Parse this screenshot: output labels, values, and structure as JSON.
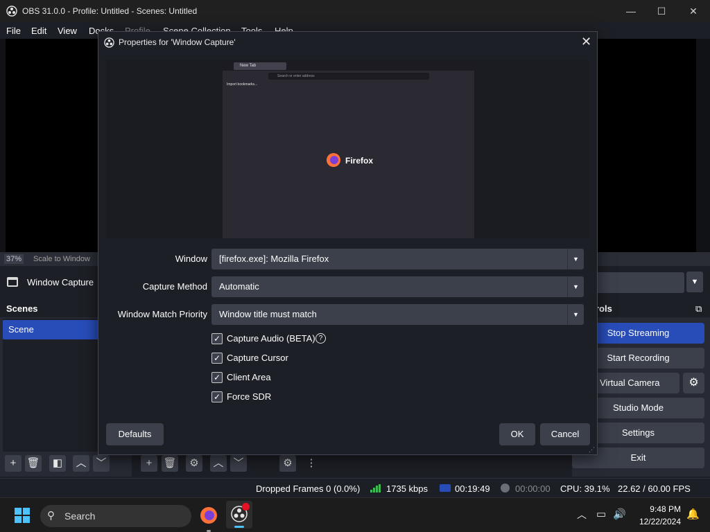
{
  "window": {
    "title": "OBS 31.0.0 - Profile: Untitled - Scenes: Untitled",
    "minimize": "—",
    "maximize": "☐",
    "close": "✕"
  },
  "menu": [
    "File",
    "Edit",
    "View",
    "Docks",
    "Profile",
    "Scene Collection",
    "Tools",
    "Help"
  ],
  "preview": {
    "zoom": "37%",
    "scale": "Scale to Window"
  },
  "source_toolbar": {
    "source_name": "Window Capture"
  },
  "scenes": {
    "title": "Scenes",
    "items": [
      "Scene"
    ]
  },
  "controls": {
    "title_fragment": "rols",
    "buttons": [
      "Stop Streaming",
      "Start Recording",
      "rt Virtual Camera",
      "Studio Mode",
      "Settings",
      "Exit"
    ]
  },
  "status": {
    "dropped_frames": "Dropped Frames 0 (0.0%)",
    "bitrate": "1735 kbps",
    "stream_time": "00:19:49",
    "record_time": "00:00:00",
    "cpu": "CPU: 39.1%",
    "fps": "22.62 / 60.00 FPS"
  },
  "taskbar": {
    "search": "Search",
    "time": "9:48 PM",
    "date": "12/22/2024"
  },
  "dialog": {
    "title": "Properties for 'Window Capture'",
    "close": "✕",
    "preview_app": "Firefox",
    "preview_tab": "New Tab",
    "preview_url": "Search or enter address",
    "preview_toolbar_note": "Import bookmarks...",
    "fields": [
      {
        "label": "Window",
        "value": "[firefox.exe]: Mozilla Firefox"
      },
      {
        "label": "Capture Method",
        "value": "Automatic"
      },
      {
        "label": "Window Match Priority",
        "value": "Window title must match"
      }
    ],
    "checkboxes": [
      {
        "label": "Capture Audio (BETA)",
        "checked": true
      },
      {
        "label": "Capture Cursor",
        "checked": true
      },
      {
        "label": "Client Area",
        "checked": true
      },
      {
        "label": "Force SDR",
        "checked": true
      }
    ],
    "help_icon": "?",
    "defaults": "Defaults",
    "ok": "OK",
    "cancel": "Cancel"
  }
}
